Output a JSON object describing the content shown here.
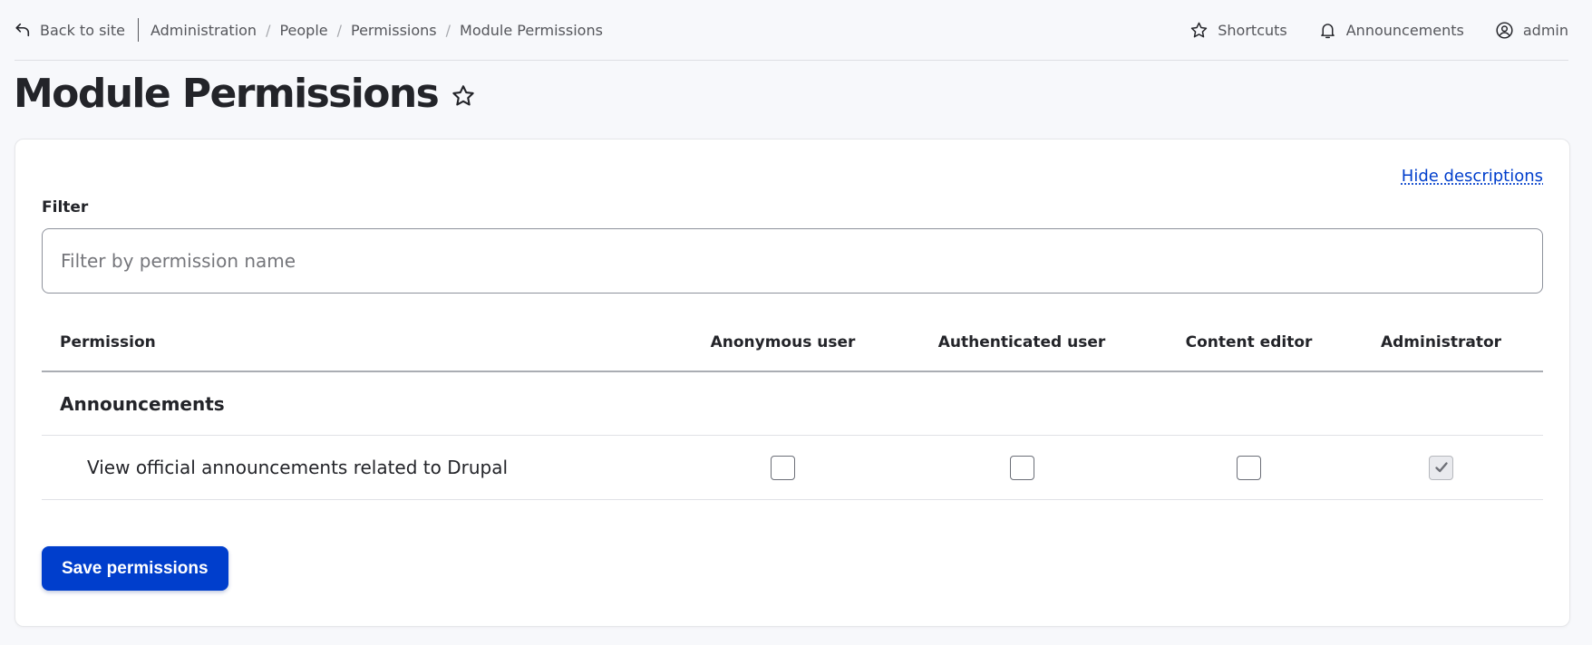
{
  "toolbar": {
    "back_label": "Back to site",
    "breadcrumbs": [
      "Administration",
      "People",
      "Permissions",
      "Module Permissions"
    ],
    "separator": "/",
    "shortcuts_label": "Shortcuts",
    "announcements_label": "Announcements",
    "user_label": "admin"
  },
  "page": {
    "title": "Module Permissions"
  },
  "card": {
    "hide_descriptions_label": "Hide descriptions",
    "filter": {
      "label": "Filter",
      "placeholder": "Filter by permission name",
      "value": ""
    },
    "table": {
      "headers": [
        "Permission",
        "Anonymous user",
        "Authenticated user",
        "Content editor",
        "Administrator"
      ],
      "groups": [
        {
          "name": "Announcements",
          "permissions": [
            {
              "name": "View official announcements related to Drupal",
              "roles": {
                "anonymous": "unchecked",
                "authenticated": "unchecked",
                "content_editor": "unchecked",
                "administrator": "checked-disabled"
              }
            }
          ]
        }
      ]
    },
    "save_label": "Save permissions"
  },
  "colors": {
    "accent": "#003ecc",
    "background": "#f7f8fb",
    "text": "#232429"
  },
  "icons": {
    "back": "back-arrow-icon",
    "shortcuts": "star-icon",
    "announcements": "bell-icon",
    "user": "user-circle-icon",
    "favorite": "star-outline-icon",
    "checkmark": "checkmark-icon"
  }
}
